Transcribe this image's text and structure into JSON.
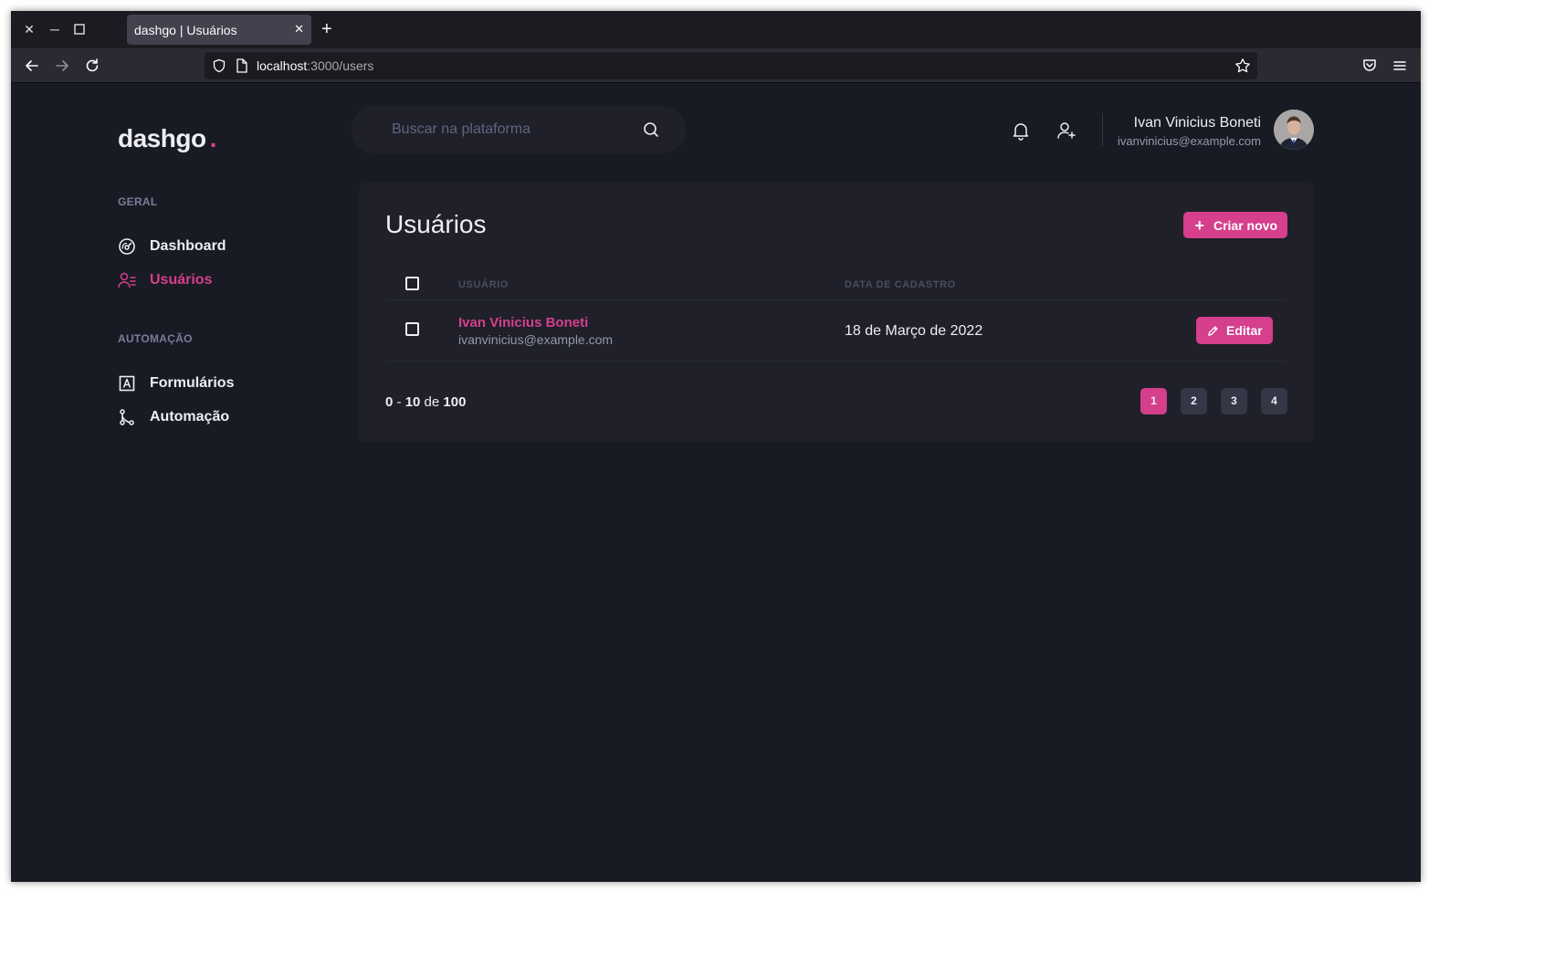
{
  "browser": {
    "tab_title": "dashgo | Usuários",
    "url_host": "localhost",
    "url_path": ":3000/users"
  },
  "header": {
    "logo_text": "dashgo",
    "logo_dot": ".",
    "search_placeholder": "Buscar na plataforma",
    "profile": {
      "name": "Ivan Vinicius Boneti",
      "email": "ivanvinicius@example.com"
    }
  },
  "sidebar": {
    "sections": [
      {
        "title": "GERAL",
        "items": [
          {
            "label": "Dashboard",
            "icon": "dashboard-icon"
          },
          {
            "label": "Usuários",
            "icon": "users-icon",
            "active": true
          }
        ]
      },
      {
        "title": "AUTOMAÇÃO",
        "items": [
          {
            "label": "Formulários",
            "icon": "forms-icon"
          },
          {
            "label": "Automação",
            "icon": "git-merge-icon"
          }
        ]
      }
    ]
  },
  "main": {
    "title": "Usuários",
    "create_button_label": "Criar novo",
    "table": {
      "columns": [
        "USUÁRIO",
        "DATA DE CADASTRO"
      ],
      "rows": [
        {
          "name": "Ivan Vinicius Boneti",
          "email": "ivanvinicius@example.com",
          "date": "18 de Março de 2022",
          "action_label": "Editar"
        }
      ]
    },
    "pagination": {
      "range_start": "0",
      "range_end": "10",
      "of_label": "de",
      "total": "100",
      "pages": [
        "1",
        "2",
        "3",
        "4"
      ],
      "current_page": "1"
    }
  },
  "colors": {
    "accent": "#d53f8c",
    "background": "#181b23",
    "card": "#1f2029",
    "text": "#eeeef2"
  }
}
